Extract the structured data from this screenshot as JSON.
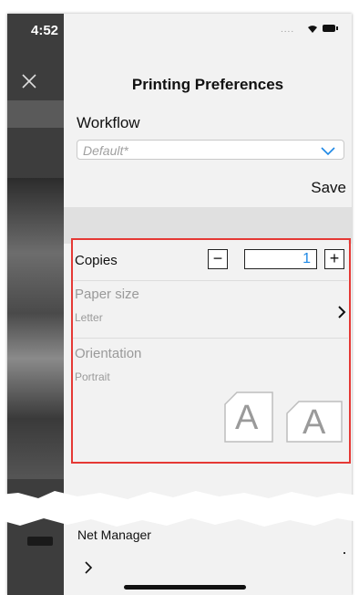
{
  "status_bar": {
    "time": "4:52",
    "signal": "....",
    "wifi_icon": "wifi-icon",
    "battery_icon": "battery-icon"
  },
  "header": {
    "title": "Printing Preferences",
    "close_icon": "close-icon"
  },
  "workflow": {
    "label": "Workflow",
    "selected": "Default*",
    "save_label": "Save"
  },
  "settings": {
    "copies": {
      "label": "Copies",
      "value": "1",
      "minus": "−",
      "plus": "+"
    },
    "paper_size": {
      "label": "Paper size",
      "value": "Letter"
    },
    "orientation": {
      "label": "Orientation",
      "value": "Portrait",
      "portrait_glyph": "A",
      "landscape_glyph": "A"
    }
  },
  "bottom": {
    "net_manager_label": "Net Manager"
  },
  "colors": {
    "highlight": "#e53935",
    "accent": "#1e88e5"
  }
}
